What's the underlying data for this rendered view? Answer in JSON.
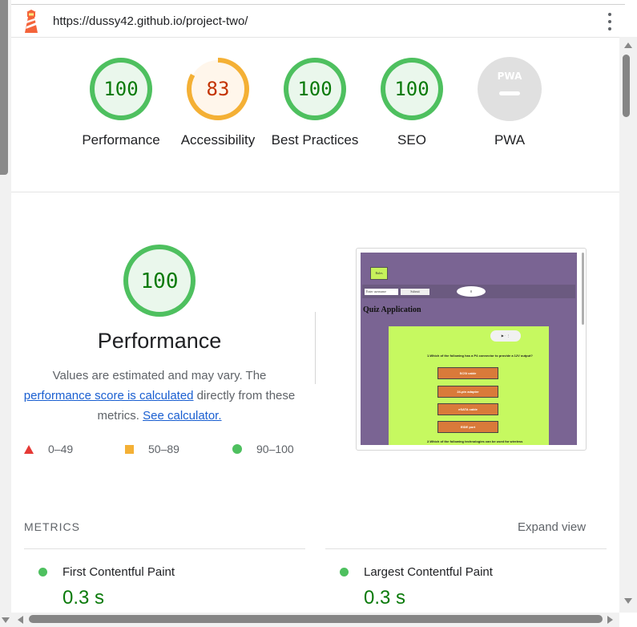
{
  "browser": {
    "url": "https://dussy42.github.io/project-two/"
  },
  "colors": {
    "pass": "#0a7a0a",
    "pass_ring": "#4ec05f",
    "average": "#c33300",
    "average_ring": "#f4b035",
    "fail": "#e53935",
    "na_ring": "#e0e0e0"
  },
  "gauges": [
    {
      "label": "Performance",
      "score": "100",
      "status": "pass",
      "value": 1.0
    },
    {
      "label": "Accessibility",
      "score": "83",
      "status": "average",
      "value": 0.83
    },
    {
      "label": "Best Practices",
      "score": "100",
      "status": "pass",
      "value": 1.0
    },
    {
      "label": "SEO",
      "score": "100",
      "status": "pass",
      "value": 1.0
    },
    {
      "label": "PWA",
      "score": "",
      "status": "na",
      "value": 0,
      "badge": "PWA"
    }
  ],
  "performance": {
    "score": "100",
    "title": "Performance",
    "desc_prefix": "Values are estimated and may vary. The ",
    "desc_link": "performance score is calculated",
    "desc_middle": " directly from these metrics. ",
    "desc_calc_link": "See calculator.",
    "legend": [
      {
        "shape": "triangle",
        "label": "0–49"
      },
      {
        "shape": "square",
        "label": "50–89"
      },
      {
        "shape": "circle",
        "label": "90–100"
      }
    ]
  },
  "screenshot": {
    "top_button": "Rules",
    "input_placeholder": "Enter username",
    "submit": "Submit",
    "score": "0",
    "title": "Quiz Application",
    "question1": "1.Which of the following has a P4 connector to provide a 12V output?",
    "options": [
      "SCSI cable",
      "24-pin adapter",
      "eSATA cable",
      "EIDE port"
    ],
    "question2": "2.Which of the following technologies can be used for wireless",
    "audio": "▶ · ⋮"
  },
  "metrics": {
    "header": "METRICS",
    "expand": "Expand view",
    "items": [
      {
        "name": "First Contentful Paint",
        "value": "0.3 s"
      },
      {
        "name": "Largest Contentful Paint",
        "value": "0.3 s"
      }
    ]
  }
}
